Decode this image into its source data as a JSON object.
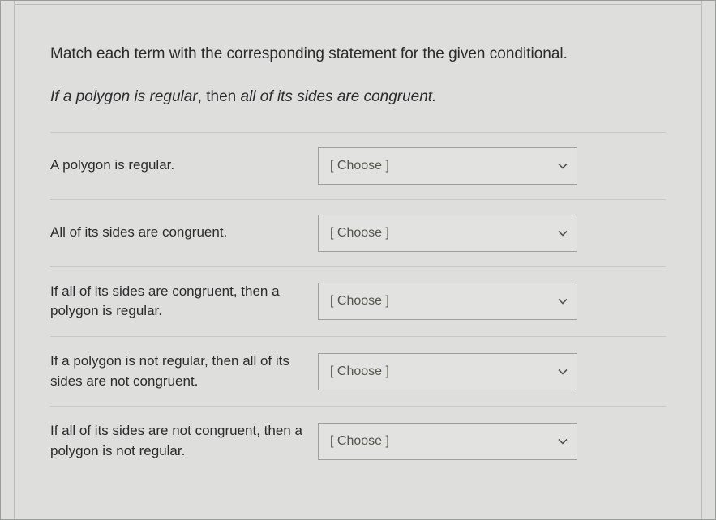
{
  "instructions": "Match each term with the corresponding statement for the given conditional.",
  "conditional": {
    "hypothesis_italic": "If a polygon is regular",
    "comma_plain": ", ",
    "then_plain": "then ",
    "conclusion_italic": "all of its sides are congruent."
  },
  "choose_label": "[ Choose ]",
  "rows": [
    {
      "prompt": "A polygon is regular."
    },
    {
      "prompt": "All of its sides are congruent."
    },
    {
      "prompt": "If all of its sides are congruent, then a polygon is regular."
    },
    {
      "prompt": "If a polygon is not regular, then all of its sides are not congruent."
    },
    {
      "prompt": "If all of its sides are not congruent, then a polygon is not regular."
    }
  ]
}
